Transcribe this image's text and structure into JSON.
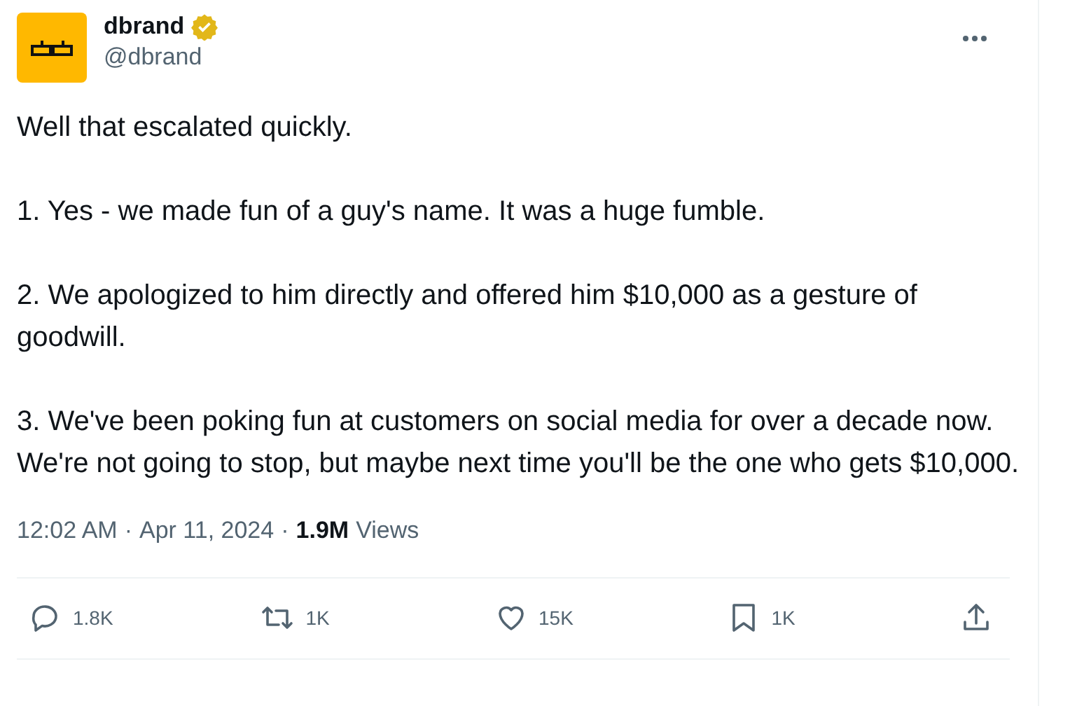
{
  "author": {
    "name": "dbrand",
    "verified": true,
    "handle": "@dbrand"
  },
  "paragraphs": [
    "Well that escalated quickly.",
    "1. Yes - we made fun of a guy's name. It was a huge fumble.",
    "2. We apologized to him directly and offered him $10,000 as a gesture of goodwill.",
    "3. We've been poking fun at customers on social media for over a decade now. We're not going to stop, but maybe next time you'll be the one who gets $10,000."
  ],
  "meta": {
    "time": "12:02 AM",
    "separator": "·",
    "date": "Apr 11, 2024",
    "views_count": "1.9M",
    "views_label": "Views"
  },
  "actions": [
    {
      "kind": "reply",
      "count": "1.8K"
    },
    {
      "kind": "repost",
      "count": "1K"
    },
    {
      "kind": "like",
      "count": "15K"
    },
    {
      "kind": "bookmark",
      "count": "1K"
    },
    {
      "kind": "share"
    }
  ]
}
